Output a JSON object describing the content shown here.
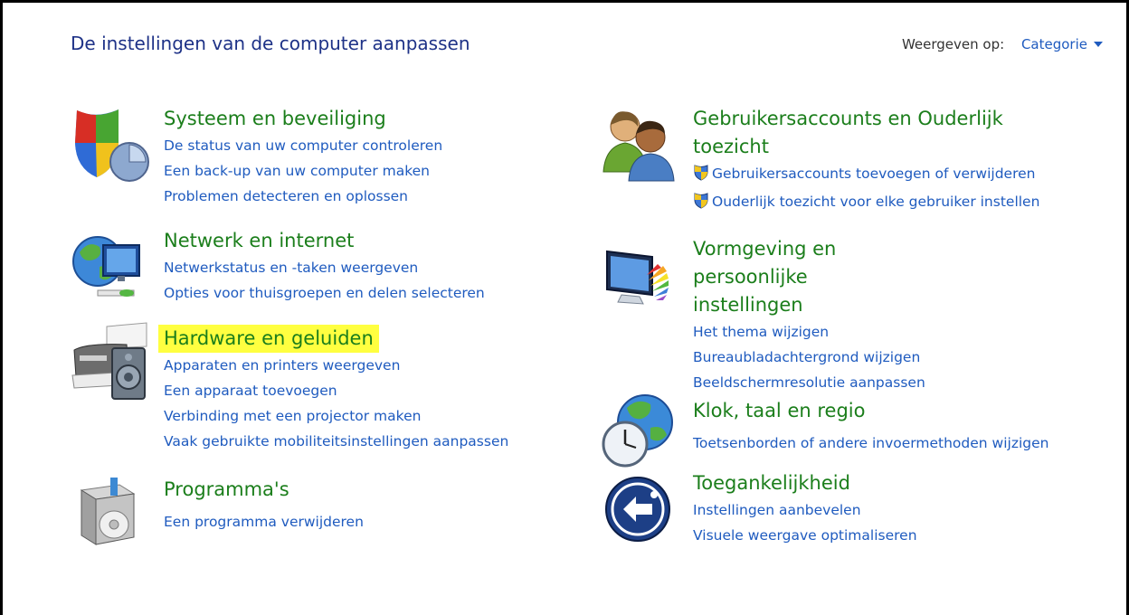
{
  "header": {
    "title": "De instellingen van de computer aanpassen",
    "view_label": "Weergeven op:",
    "view_value": "Categorie"
  },
  "categories": {
    "security": {
      "heading": "Systeem en beveiliging",
      "icon": "security-shield-icon",
      "links": [
        "De status van uw computer controleren",
        "Een back-up van uw computer maken",
        "Problemen detecteren en oplossen"
      ]
    },
    "network": {
      "heading": "Netwerk en internet",
      "icon": "network-globe-icon",
      "links": [
        "Netwerkstatus en -taken weergeven",
        "Opties voor thuisgroepen en delen selecteren"
      ]
    },
    "hardware": {
      "heading": "Hardware en geluiden",
      "icon": "printer-speaker-icon",
      "highlighted": true,
      "highlight_color": "#ffff40",
      "links": [
        "Apparaten en printers weergeven",
        "Een apparaat toevoegen",
        "Verbinding met een projector maken",
        "Vaak gebruikte mobiliteitsinstellingen aanpassen"
      ]
    },
    "programs": {
      "heading": "Programma's",
      "icon": "programs-box-icon",
      "links": [
        "Een programma verwijderen"
      ]
    },
    "users": {
      "heading_line1": "Gebruikersaccounts en Ouderlijk",
      "heading_line2": "toezicht",
      "icon": "users-icon",
      "links": [
        "Gebruikersaccounts toevoegen of verwijderen",
        "Ouderlijk toezicht voor elke gebruiker instellen"
      ]
    },
    "appearance": {
      "heading_line1": "Vormgeving en persoonlijke",
      "heading_line2": "instellingen",
      "icon": "monitor-palette-icon",
      "links": [
        "Het thema wijzigen",
        "Bureaubladachtergrond wijzigen",
        "Beeldschermresolutie aanpassen"
      ]
    },
    "clock": {
      "heading": "Klok, taal en regio",
      "icon": "clock-globe-icon",
      "links": [
        "Toetsenborden of andere invoermethoden wijzigen"
      ]
    },
    "access": {
      "heading": "Toegankelijkheid",
      "icon": "accessibility-icon",
      "links": [
        "Instellingen aanbevelen",
        "Visuele weergave optimaliseren"
      ]
    }
  },
  "colors": {
    "title": "#1e3287",
    "heading": "#1b7e1b",
    "link": "#1f5bbf",
    "highlight": "#ffff40"
  }
}
